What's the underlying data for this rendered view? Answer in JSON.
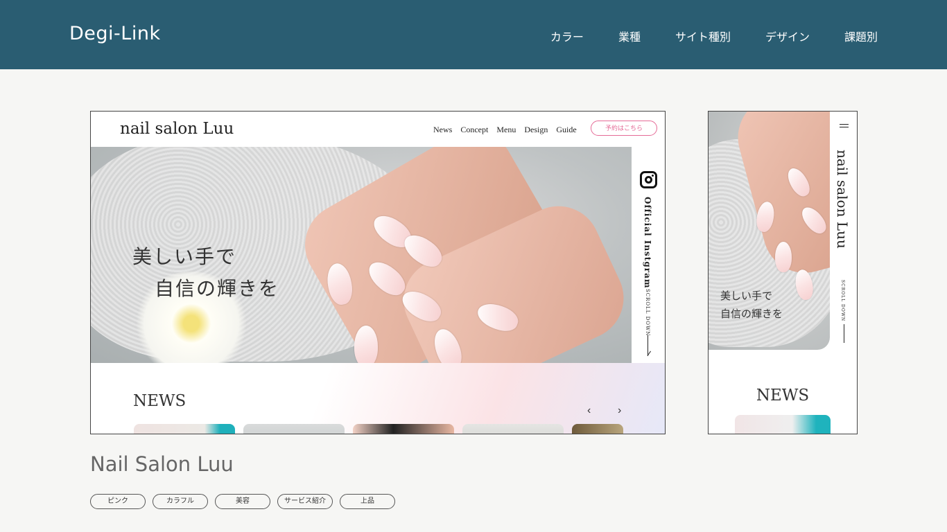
{
  "header": {
    "logo": "Degi-Link",
    "nav": [
      "カラー",
      "業種",
      "サイト種別",
      "デザイン",
      "課題別"
    ]
  },
  "pc_preview": {
    "logo": "nail salon Luu",
    "nav": [
      "News",
      "Concept",
      "Menu",
      "Design",
      "Guide"
    ],
    "reserve_button": "予約はこちら",
    "hero_line1": "美しい手で",
    "hero_line2": "自信の輝きを",
    "instagram_label": "Official Instgram",
    "scroll_label": "SCROLL DOWN",
    "news_title": "NEWS",
    "prev_arrow": "‹",
    "next_arrow": "›"
  },
  "sp_preview": {
    "logo": "nail salon Luu",
    "hero_line1": "美しい手で",
    "hero_line2": "自信の輝きを",
    "scroll_label": "SCROLL DOWN",
    "news_title": "NEWS"
  },
  "site": {
    "title": "Nail Salon Luu",
    "tags": [
      "ピンク",
      "カラフル",
      "美容",
      "サービス紹介",
      "上品"
    ]
  },
  "colors": {
    "header_bg": "#2a5d72",
    "page_bg": "#f6f6f4",
    "accent_pink": "#e56a96"
  }
}
